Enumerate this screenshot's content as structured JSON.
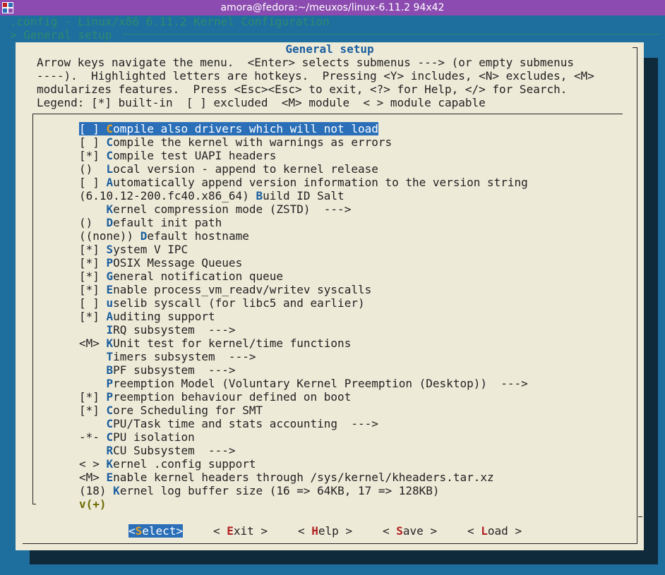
{
  "window": {
    "title": "amora@fedora:~/meuxos/linux-6.11.2 94x42"
  },
  "background": {
    "config_title": ".config - Linux/x86 6.11.2 Kernel Configuration",
    "breadcrumb": "> General setup"
  },
  "dialog": {
    "title": "General setup",
    "help_lines": [
      "Arrow keys navigate the menu.  <Enter> selects submenus ---> (or empty submenus",
      "----).  Highlighted letters are hotkeys.  Pressing <Y> includes, <N> excludes, <M>",
      "modularizes features.  Press <Esc><Esc> to exit, <?> for Help, </> for Search.",
      "Legend: [*] built-in  [ ] excluded  <M> module  < > module capable"
    ],
    "items": [
      {
        "prefix": "[ ] ",
        "hotkey": "C",
        "rest": "ompile also drivers which will not load",
        "selected": true
      },
      {
        "prefix": "[ ] ",
        "hotkey": "C",
        "rest": "ompile the kernel with warnings as errors"
      },
      {
        "prefix": "[*] ",
        "hotkey": "C",
        "rest": "ompile test UAPI headers"
      },
      {
        "prefix": "()  ",
        "hotkey": "L",
        "rest": "ocal version - append to kernel release"
      },
      {
        "prefix": "[ ] ",
        "hotkey": "A",
        "rest": "utomatically append version information to the version string"
      },
      {
        "prefix": "(6.10.12-200.fc40.x86_64) ",
        "hotkey": "B",
        "rest": "uild ID Salt"
      },
      {
        "prefix": "    ",
        "hotkey": "K",
        "rest": "ernel compression mode (ZSTD)  --->"
      },
      {
        "prefix": "()  ",
        "hotkey": "D",
        "rest": "efault init path"
      },
      {
        "prefix": "((none)) ",
        "hotkey": "D",
        "rest": "efault hostname"
      },
      {
        "prefix": "[*] ",
        "hotkey": "S",
        "rest": "ystem V IPC"
      },
      {
        "prefix": "[*] ",
        "hotkey": "P",
        "rest": "OSIX Message Queues"
      },
      {
        "prefix": "[*] ",
        "hotkey": "G",
        "rest": "eneral notification queue"
      },
      {
        "prefix": "[*] ",
        "hotkey": "E",
        "rest": "nable process_vm_readv/writev syscalls"
      },
      {
        "prefix": "[ ] ",
        "hotkey": "u",
        "rest": "selib syscall (for libc5 and earlier)"
      },
      {
        "prefix": "[*] ",
        "hotkey": "A",
        "rest": "uditing support"
      },
      {
        "prefix": "    ",
        "hotkey": "I",
        "rest": "RQ subsystem  --->"
      },
      {
        "prefix": "<M> ",
        "hotkey": "K",
        "rest": "Unit test for kernel/time functions"
      },
      {
        "prefix": "    ",
        "hotkey": "T",
        "rest": "imers subsystem  --->"
      },
      {
        "prefix": "    ",
        "hotkey": "B",
        "rest": "PF subsystem  --->"
      },
      {
        "prefix": "    ",
        "hotkey": "P",
        "rest": "reemption Model (Voluntary Kernel Preemption (Desktop))  --->"
      },
      {
        "prefix": "[*] ",
        "hotkey": "P",
        "rest": "reemption behaviour defined on boot"
      },
      {
        "prefix": "[*] ",
        "hotkey": "C",
        "rest": "ore Scheduling for SMT"
      },
      {
        "prefix": "    ",
        "hotkey": "C",
        "rest": "PU/Task time and stats accounting  --->"
      },
      {
        "prefix": "-*- ",
        "hotkey": "C",
        "rest": "PU isolation"
      },
      {
        "prefix": "    ",
        "hotkey": "R",
        "rest": "CU Subsystem  --->"
      },
      {
        "prefix": "< > ",
        "hotkey": "K",
        "rest": "ernel .config support"
      },
      {
        "prefix": "<M> ",
        "hotkey": "E",
        "rest": "nable kernel headers through /sys/kernel/kheaders.tar.xz"
      },
      {
        "prefix": "(18) ",
        "hotkey": "K",
        "rest": "ernel log buffer size (16 => 64KB, 17 => 128KB)"
      }
    ],
    "more_indicator": "v(+)",
    "buttons": [
      {
        "name": "select",
        "pre": "<",
        "hk": "S",
        "rest": "elect>",
        "active": true
      },
      {
        "name": "exit",
        "pre": "< ",
        "hk": "E",
        "rest": "xit >"
      },
      {
        "name": "help",
        "pre": "< ",
        "hk": "H",
        "rest": "elp >"
      },
      {
        "name": "save",
        "pre": "< ",
        "hk": "S",
        "rest": "ave >"
      },
      {
        "name": "load",
        "pre": "< ",
        "hk": "L",
        "rest": "oad >"
      }
    ]
  },
  "colors": {
    "terminal_bg": "#1e6e9e",
    "titlebar": "#8c4bb0",
    "dialog_bg": "#eeead8",
    "accent": "#1a5e9e",
    "selection": "#2a6fb8",
    "hotkey_button": "#b02020"
  }
}
